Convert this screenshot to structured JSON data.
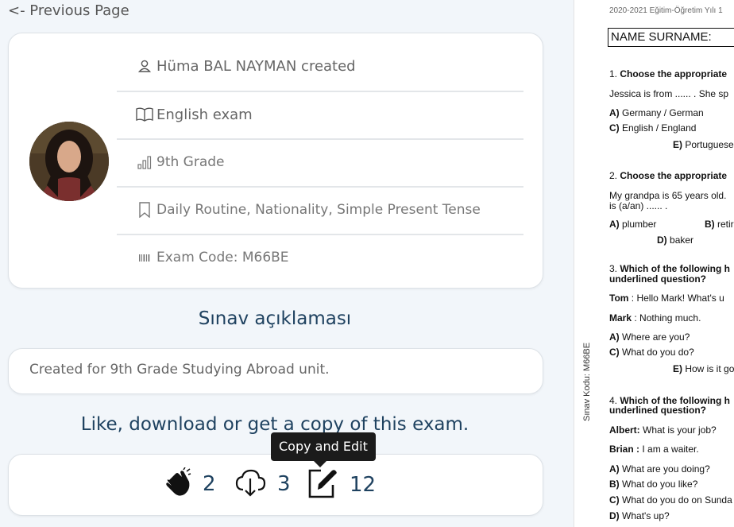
{
  "nav": {
    "previous_label": "<- Previous Page"
  },
  "exam": {
    "creator": "Hüma BAL NAYMAN created",
    "name": "English exam",
    "grade": "9th Grade",
    "topics": "Daily Routine, Nationality, Simple Present Tense",
    "code": "Exam Code: M66BE"
  },
  "description": {
    "title": "Sınav açıklaması",
    "text": "Created for 9th Grade Studying Abroad unit."
  },
  "actions": {
    "title": "Like, download or get a copy of this exam.",
    "likes": "2",
    "downloads": "3",
    "copies": "12",
    "tooltip": "Copy and Edit"
  },
  "document": {
    "header": "2020-2021 Eğitim-Öğretim Yılı 1",
    "name_field": "NAME SURNAME:",
    "side_code": "Sınav Kodu: M66BE",
    "q1_num": "1.",
    "q1_title": "Choose the appropriate",
    "q1_text": "Jessica is from ...... . She sp",
    "q1_a_letter": "A)",
    "q1_a": "Germany / German",
    "q1_c_letter": "C)",
    "q1_c": "English / England",
    "q1_e_letter": "E)",
    "q1_e": "Portuguese",
    "q2_num": "2.",
    "q2_title": "Choose the appropriate",
    "q2_text1": "My grandpa is 65 years old.",
    "q2_text2": "is (a/an) ...... .",
    "q2_a_letter": "A)",
    "q2_a": "plumber",
    "q2_b_letter": "B)",
    "q2_b": "retir",
    "q2_d_letter": "D)",
    "q2_d": "baker",
    "q3_num": "3.",
    "q3_title1": "Which of the following h",
    "q3_title2": "underlined question?",
    "q3_tom": "Tom",
    "q3_tom_text": ": Hello Mark!  What's u",
    "q3_mark": "Mark",
    "q3_mark_text": ": Nothing much.",
    "q3_a_letter": "A)",
    "q3_a": "Where are you?",
    "q3_c_letter": "C)",
    "q3_c": "What do you do?",
    "q3_e_letter": "E)",
    "q3_e": "How is it go",
    "q4_num": "4.",
    "q4_title1": "Which of the following h",
    "q4_title2": "underlined question?",
    "q4_albert": "Albert:",
    "q4_albert_text": "What is your job?",
    "q4_brian": "Brian :",
    "q4_brian_text": "I am a waiter.",
    "q4_a_letter": "A)",
    "q4_a": "What are you doing?",
    "q4_b_letter": "B)",
    "q4_b": "What do you like?",
    "q4_c_letter": "C)",
    "q4_c": "What do you do on Sunda",
    "q4_d_letter": "D)",
    "q4_d": "What's up?"
  },
  "colors": {
    "accent": "#1f4260",
    "tooltip_bg": "#1b1b1b"
  }
}
